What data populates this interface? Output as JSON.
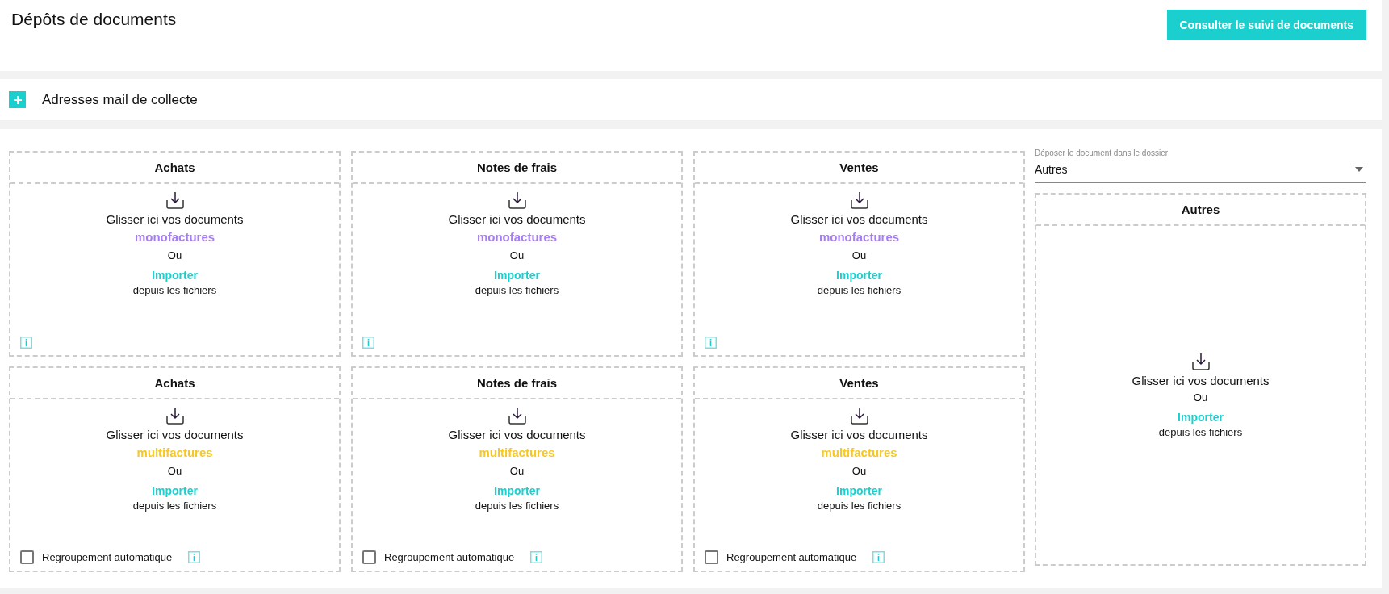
{
  "page": {
    "title": "Dépôts de documents",
    "action_button": "Consulter le suivi de documents"
  },
  "collect_section": {
    "label": "Adresses mail de collecte",
    "expanded": false
  },
  "drop_zones": [
    {
      "title": "Achats",
      "prompt": "Glisser ici vos documents",
      "type_label": "monofactures",
      "color": "#a47ef2",
      "or_text": "Ou",
      "import_link": "Importer",
      "import_suffix": "depuis les fichiers"
    },
    {
      "title": "Notes de frais",
      "prompt": "Glisser ici vos documents",
      "type_label": "monofactures",
      "color": "#a47ef2",
      "or_text": "Ou",
      "import_link": "Importer",
      "import_suffix": "depuis les fichiers"
    },
    {
      "title": "Ventes",
      "prompt": "Glisser ici vos documents",
      "type_label": "monofactures",
      "color": "#a47ef2",
      "or_text": "Ou",
      "import_link": "Importer",
      "import_suffix": "depuis les fichiers"
    },
    {
      "title": "Achats",
      "prompt": "Glisser ici vos documents",
      "type_label": "multifactures",
      "color": "#f7c820",
      "or_text": "Ou",
      "import_link": "Importer",
      "import_suffix": "depuis les fichiers",
      "auto_group": {
        "label": "Regroupement automatique",
        "checked": false
      }
    },
    {
      "title": "Notes de frais",
      "prompt": "Glisser ici vos documents",
      "type_label": "multifactures",
      "color": "#f7c820",
      "or_text": "Ou",
      "import_link": "Importer",
      "import_suffix": "depuis les fichiers",
      "auto_group": {
        "label": "Regroupement automatique",
        "checked": false
      }
    },
    {
      "title": "Ventes",
      "prompt": "Glisser ici vos documents",
      "type_label": "multifactures",
      "color": "#f7c820",
      "or_text": "Ou",
      "import_link": "Importer",
      "import_suffix": "depuis les fichiers",
      "auto_group": {
        "label": "Regroupement automatique",
        "checked": false
      }
    }
  ],
  "folder_select": {
    "label": "Déposer le document dans le dossier",
    "value": "Autres"
  },
  "other_zone": {
    "title": "Autres",
    "prompt": "Glisser ici vos documents",
    "or_text": "Ou",
    "import_link": "Importer",
    "import_suffix": "depuis les fichiers"
  }
}
